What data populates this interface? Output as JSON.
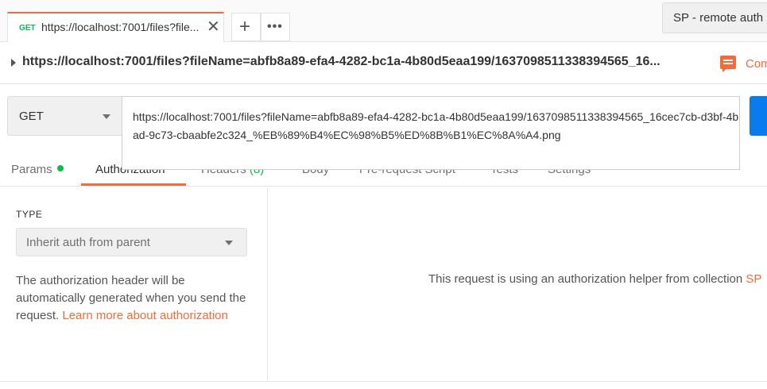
{
  "tab": {
    "method": "GET",
    "title": "https://localhost:7001/files?file...",
    "close": "✕"
  },
  "tab_actions": {
    "plus": "+",
    "more": "•••"
  },
  "environment": {
    "label": "SP - remote auth"
  },
  "request_title": "https://localhost:7001/files?fileName=abfb8a89-efa4-4282-bc1a-4b80d5eaa199/1637098511338394565_16...",
  "comments_label": "Comments",
  "method": "GET",
  "url": "https://localhost:7001/files?fileName=abfb8a89-efa4-4282-bc1a-4b80d5eaa199/1637098511338394565_16cec7cb-d3bf-4bad-9c73-cbaabfe2c324_%EB%89%B4%EC%98%B5%ED%8B%B1%EC%8A%A4.png",
  "subtabs": {
    "params": "Params",
    "authorization": "Authorization",
    "headers": "Headers",
    "headers_count": "(8)",
    "body": "Body",
    "prerequest": "Pre-request Script",
    "tests": "Tests",
    "settings": "Settings"
  },
  "auth": {
    "type_label": "TYPE",
    "type_value": "Inherit auth from parent",
    "description": "The authorization header will be automatically generated when you send the request.",
    "learn_more": "Learn more about authorization",
    "helper_message": "This request is using an authorization helper from collection",
    "helper_link": "SP"
  },
  "colors": {
    "accent": "#f26b3a",
    "get_method": "#0cbb52",
    "send_button": "#097bed"
  }
}
